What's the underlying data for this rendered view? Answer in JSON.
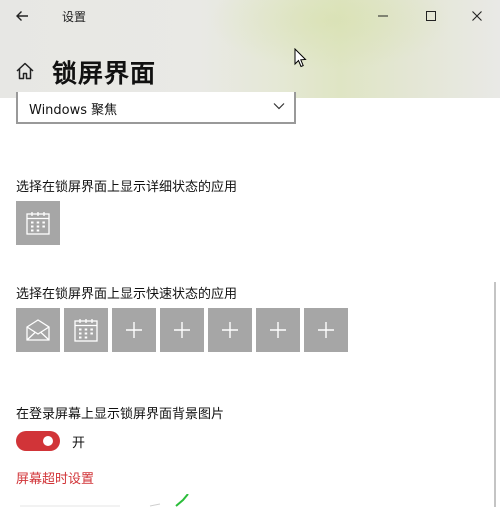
{
  "window": {
    "app_title": "设置",
    "accent_color": "#d13438",
    "tile_color": "#a6a6a6"
  },
  "icons": {
    "back": "back-arrow-icon",
    "minimize": "minimize-icon",
    "maximize": "maximize-icon",
    "close": "close-icon",
    "home": "home-icon",
    "dropdown": "chevron-down-icon",
    "calendar": "calendar-icon",
    "mail": "mail-icon",
    "add": "plus-icon"
  },
  "page": {
    "title": "锁屏界面"
  },
  "background_dropdown": {
    "selected": "Windows 聚焦"
  },
  "detailed_status": {
    "label": "选择在锁屏界面上显示详细状态的应用",
    "apps": [
      "calendar"
    ]
  },
  "quick_status": {
    "label": "选择在锁屏界面上显示快速状态的应用",
    "apps": [
      "mail",
      "calendar",
      "add",
      "add",
      "add",
      "add",
      "add"
    ]
  },
  "signin_background": {
    "label": "在登录屏幕上显示锁屏界面背景图片",
    "toggle_on": true,
    "toggle_state_text": "开"
  },
  "links": {
    "screen_timeout": "屏幕超时设置"
  }
}
